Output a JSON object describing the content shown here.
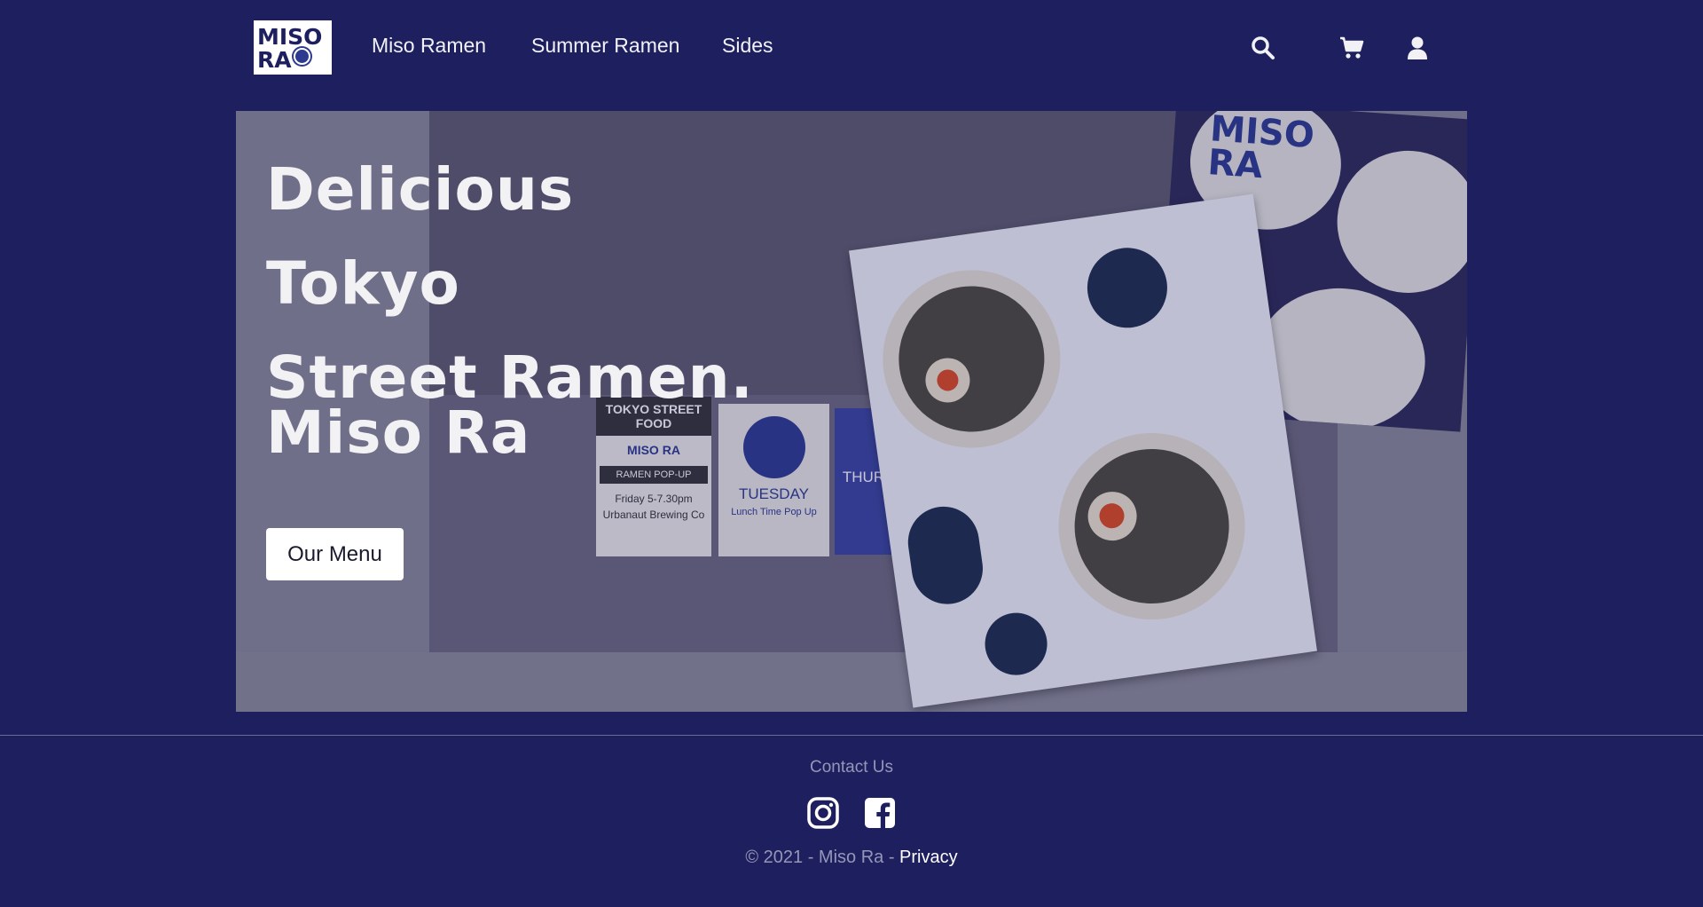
{
  "header": {
    "logo": {
      "line1": "MISO",
      "line2": "RA"
    },
    "nav": [
      {
        "label": "Miso Ramen"
      },
      {
        "label": "Summer Ramen"
      },
      {
        "label": "Sides"
      }
    ],
    "icons": [
      "search-icon",
      "cart-icon",
      "user-icon"
    ]
  },
  "hero": {
    "title_line1": "Delicious Tokyo",
    "title_line2": "Street Ramen.",
    "subtitle": "Miso Ra",
    "cta_label": "Our Menu",
    "background_signs": {
      "sign1_title": "TOKYO STREET FOOD",
      "sign1_brand": "MISO RA",
      "sign1_tag": "RAMEN POP-UP",
      "sign1_time": "Friday 5-7.30pm",
      "sign1_venue": "Urbanaut Brewing Co",
      "sign2_day": "TUESDAY",
      "sign2_detail": "Lunch Time Pop Up",
      "sign3_day": "THURSDAY"
    },
    "coaster_text": "MISO RA"
  },
  "footer": {
    "contact_label": "Contact Us",
    "social_icons": [
      "instagram-icon",
      "facebook-icon"
    ],
    "copyright": "© 2021 - Miso Ra - ",
    "privacy_label": "Privacy"
  },
  "colors": {
    "background": "#1e1f5e",
    "button_bg": "#ffffff",
    "muted_text": "#9596b8"
  }
}
